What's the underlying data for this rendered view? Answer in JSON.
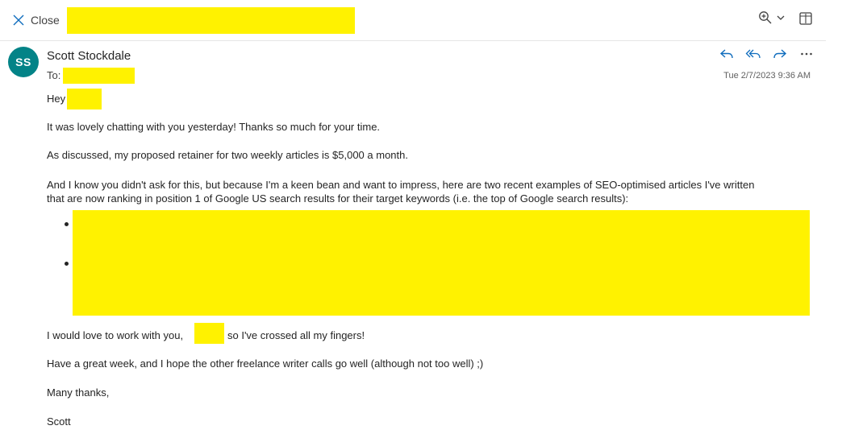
{
  "header": {
    "close_label": "Close",
    "icons": {
      "close": "close-icon",
      "zoom": "zoom-icon",
      "zoom_dropdown": "chevron-down-icon",
      "expand": "open-in-new-window-icon"
    }
  },
  "message": {
    "avatar_initials": "SS",
    "avatar_color": "#038387",
    "sender_name": "Scott Stockdale",
    "to_label": "To:",
    "timestamp": "Tue 2/7/2023 9:36 AM",
    "actions": {
      "reply": "reply-icon",
      "reply_all": "reply-all-icon",
      "forward": "forward-icon",
      "more": "more-icon"
    },
    "accent_color": "#0f6cbd",
    "redaction_color": "#fff200",
    "body": {
      "greeting": "Hey",
      "p1": "It was lovely chatting with you yesterday! Thanks so much for your time.",
      "p2": "As discussed, my proposed retainer for two weekly articles is $5,000 a month.",
      "p3_line1": "And I know you didn't ask for this, but because I'm a keen bean and want to impress, here are two recent examples of SEO-optimised articles I've written",
      "p3_line2": "that are now ranking in position 1 of Google US search results for their target keywords (i.e. the top of Google search results):",
      "p4_part1": "I would love to work with you,",
      "p4_part2": "so I've crossed all my fingers!",
      "p5": "Have a great week, and I hope the other freelance writer calls go well (although not too well) ;)",
      "p6": "Many thanks,",
      "signature": "Scott"
    }
  }
}
